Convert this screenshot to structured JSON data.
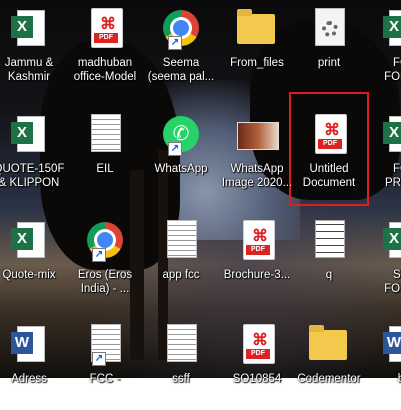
{
  "desktop": {
    "icons": [
      {
        "label": "Jammu &\nKashmir",
        "type": "excel",
        "icon": "excel-icon"
      },
      {
        "label": "madhuban\noffice-Model",
        "type": "pdf",
        "icon": "pdf-icon"
      },
      {
        "label": "Seema\n(seema pal...",
        "type": "chrome",
        "icon": "chrome-icon",
        "shortcut": true
      },
      {
        "label": "From_files",
        "type": "folder",
        "icon": "folder-icon"
      },
      {
        "label": "print",
        "type": "gear",
        "icon": "gear-doc-icon"
      },
      {
        "label": "FO\nFORM",
        "type": "excel",
        "icon": "excel-icon"
      },
      {
        "label": "QUOTE-150F\n& KLIPPON",
        "type": "excel",
        "icon": "excel-icon"
      },
      {
        "label": "EIL",
        "type": "text",
        "icon": "text-doc-icon"
      },
      {
        "label": "WhatsApp",
        "type": "whatsapp",
        "icon": "whatsapp-icon",
        "shortcut": true
      },
      {
        "label": "WhatsApp\nImage 2020...",
        "type": "image",
        "icon": "image-icon"
      },
      {
        "label": "Untitled\nDocument",
        "type": "pdf",
        "icon": "pdf-icon",
        "selected": true
      },
      {
        "label": "FO\nPROF",
        "type": "excel",
        "icon": "excel-icon"
      },
      {
        "label": "Quote-mix",
        "type": "excel",
        "icon": "excel-icon"
      },
      {
        "label": "Eros (Eros\nIndia) - ...",
        "type": "chrome",
        "icon": "chrome-icon",
        "shortcut": true
      },
      {
        "label": "app fcc",
        "type": "text",
        "icon": "text-doc-icon"
      },
      {
        "label": "Brochure-3...",
        "type": "pdf",
        "icon": "pdf-icon"
      },
      {
        "label": "q",
        "type": "scan",
        "icon": "scan-doc-icon"
      },
      {
        "label": "SU\nFORM",
        "type": "excel",
        "icon": "excel-icon"
      },
      {
        "label": "Adress",
        "type": "word",
        "icon": "word-icon"
      },
      {
        "label": "FCC -",
        "type": "text",
        "icon": "text-doc-icon",
        "shortcut": true
      },
      {
        "label": "ssff",
        "type": "text",
        "icon": "text-doc-icon"
      },
      {
        "label": "SO10854",
        "type": "pdf",
        "icon": "pdf-icon"
      },
      {
        "label": "Codementor",
        "type": "folder",
        "icon": "folder-icon"
      },
      {
        "label": "b",
        "type": "word",
        "icon": "word-icon"
      }
    ],
    "pdf_badge": "PDF",
    "excel_letter": "X",
    "word_letter": "W",
    "shortcut_arrow": "↗",
    "selection_color": "#e21b1b"
  }
}
